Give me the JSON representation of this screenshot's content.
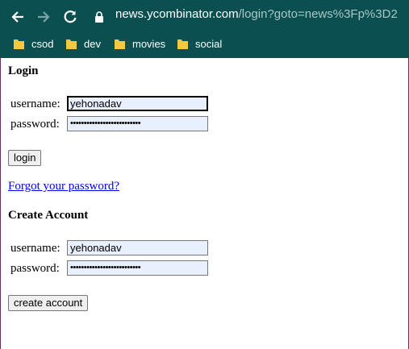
{
  "browser": {
    "url_host": "news.ycombinator.com",
    "url_path": "/login?goto=news%3Fp%3D2",
    "bookmarks": [
      {
        "label": "csod"
      },
      {
        "label": "dev"
      },
      {
        "label": "movies"
      },
      {
        "label": "social"
      }
    ],
    "colors": {
      "toolbar": "#0b4f51"
    }
  },
  "login": {
    "heading": "Login",
    "username_label": "username:",
    "password_label": "password:",
    "username_value": "yehonadav",
    "password_mask": "••••••••••••••••••••••••••",
    "button": "login",
    "forgot_link": "Forgot your password?"
  },
  "create": {
    "heading": "Create Account",
    "username_label": "username:",
    "password_label": "password:",
    "username_value": "yehonadav",
    "password_mask": "••••••••••••••••••••••••••",
    "button": "create account"
  }
}
